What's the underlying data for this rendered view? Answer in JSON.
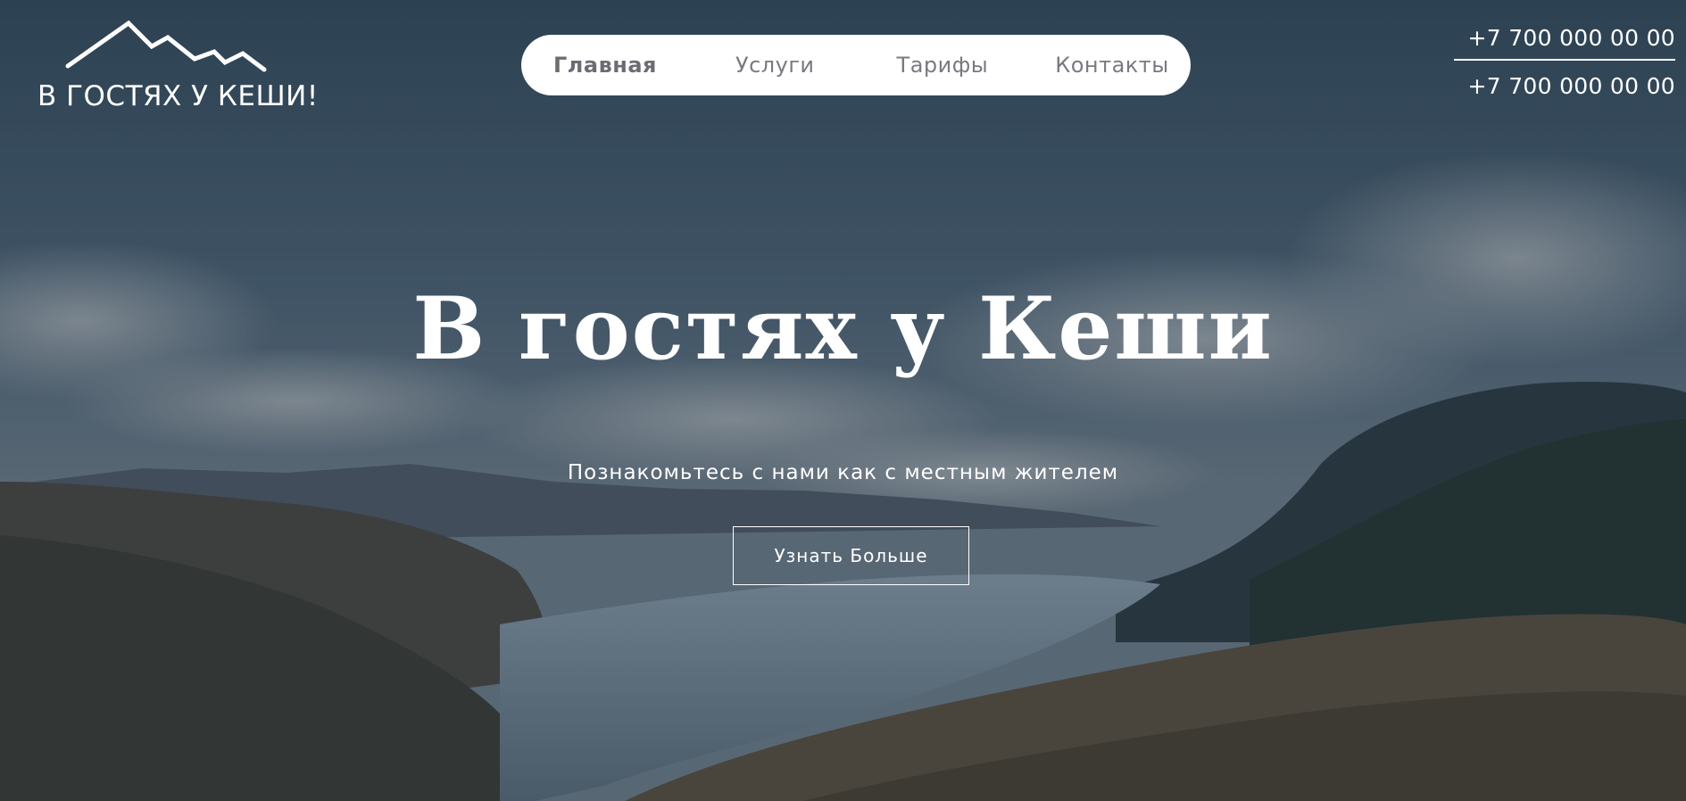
{
  "logo": {
    "icon": "mountain-icon",
    "text": "В ГОСТЯХ У КЕШИ!"
  },
  "nav": {
    "items": [
      {
        "label": "Главная",
        "active": true
      },
      {
        "label": "Услуги",
        "active": false
      },
      {
        "label": "Тарифы",
        "active": false
      },
      {
        "label": "Контакты",
        "active": false
      }
    ]
  },
  "contacts": {
    "phone_1": "+7 700 000 00 00",
    "phone_2": "+7 700 000 00 00"
  },
  "hero": {
    "title": "В гостях у Кеши",
    "subtitle": "Познакомьтесь с нами как с местным жителем",
    "cta_label": "Узнать Больше"
  },
  "colors": {
    "nav_background": "#ffffff",
    "nav_text": "#7c7881",
    "hero_text": "#ffffff",
    "overlay": "#1e2d3d"
  }
}
